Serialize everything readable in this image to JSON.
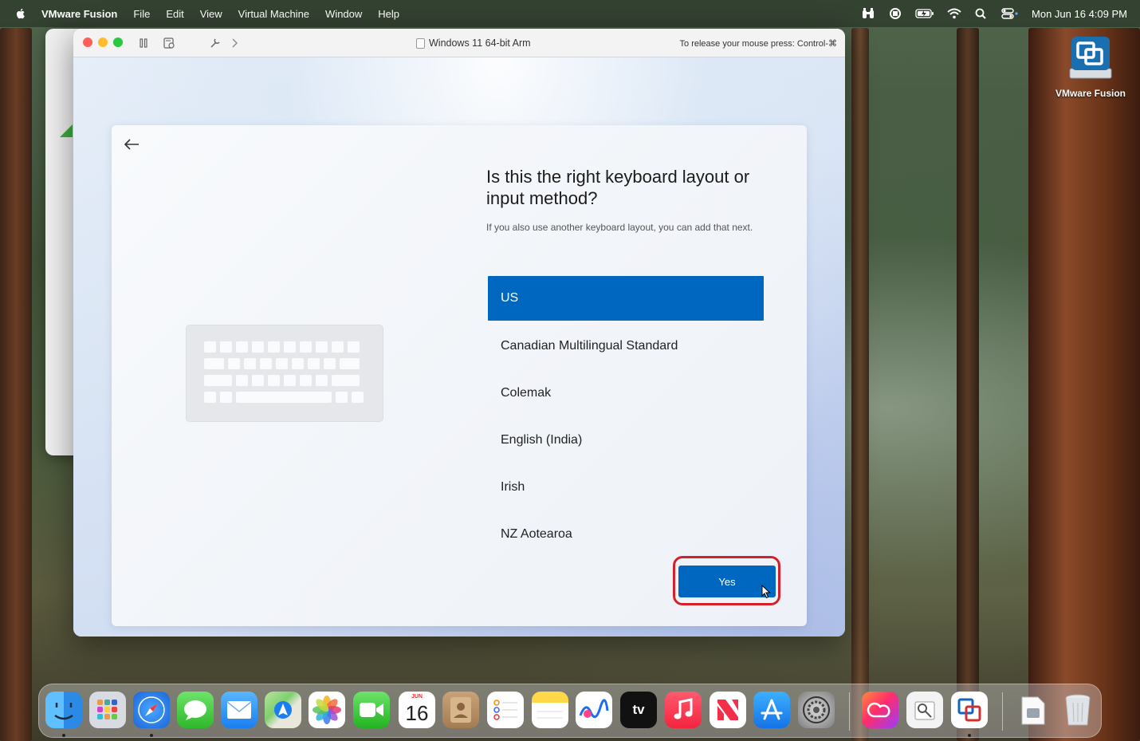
{
  "menubar": {
    "app_name": "VMware Fusion",
    "menus": [
      "File",
      "Edit",
      "View",
      "Virtual Machine",
      "Window",
      "Help"
    ],
    "datetime": "Mon Jun 16  4:09 PM"
  },
  "vm_window": {
    "title": "Windows 11 64-bit Arm",
    "release_hint": "To release your mouse press: Control-⌘"
  },
  "oobe": {
    "question": "Is this the right keyboard layout or input method?",
    "subtext": "If you also use another keyboard layout, you can add that next.",
    "layouts": [
      "US",
      "Canadian Multilingual Standard",
      "Colemak",
      "English (India)",
      "Irish",
      "NZ Aotearoa"
    ],
    "selected_layout": "US",
    "yes_label": "Yes"
  },
  "desktop_icon": {
    "label": "VMware Fusion"
  },
  "dock": {
    "calendar_month": "JUN",
    "calendar_day": "16",
    "apps": [
      "Finder",
      "Launchpad",
      "Safari",
      "Messages",
      "Mail",
      "Maps",
      "Photos",
      "FaceTime",
      "Calendar",
      "Contacts",
      "Reminders",
      "Notes",
      "Freeform",
      "TV",
      "Music",
      "News",
      "App Store",
      "System Settings",
      "Creative Cloud",
      "Preview",
      "VMware Fusion",
      "Downloads",
      "Trash"
    ],
    "tv_label": "tv"
  },
  "colors": {
    "selection_blue": "#0067c0",
    "highlight_red": "#d4202a"
  }
}
